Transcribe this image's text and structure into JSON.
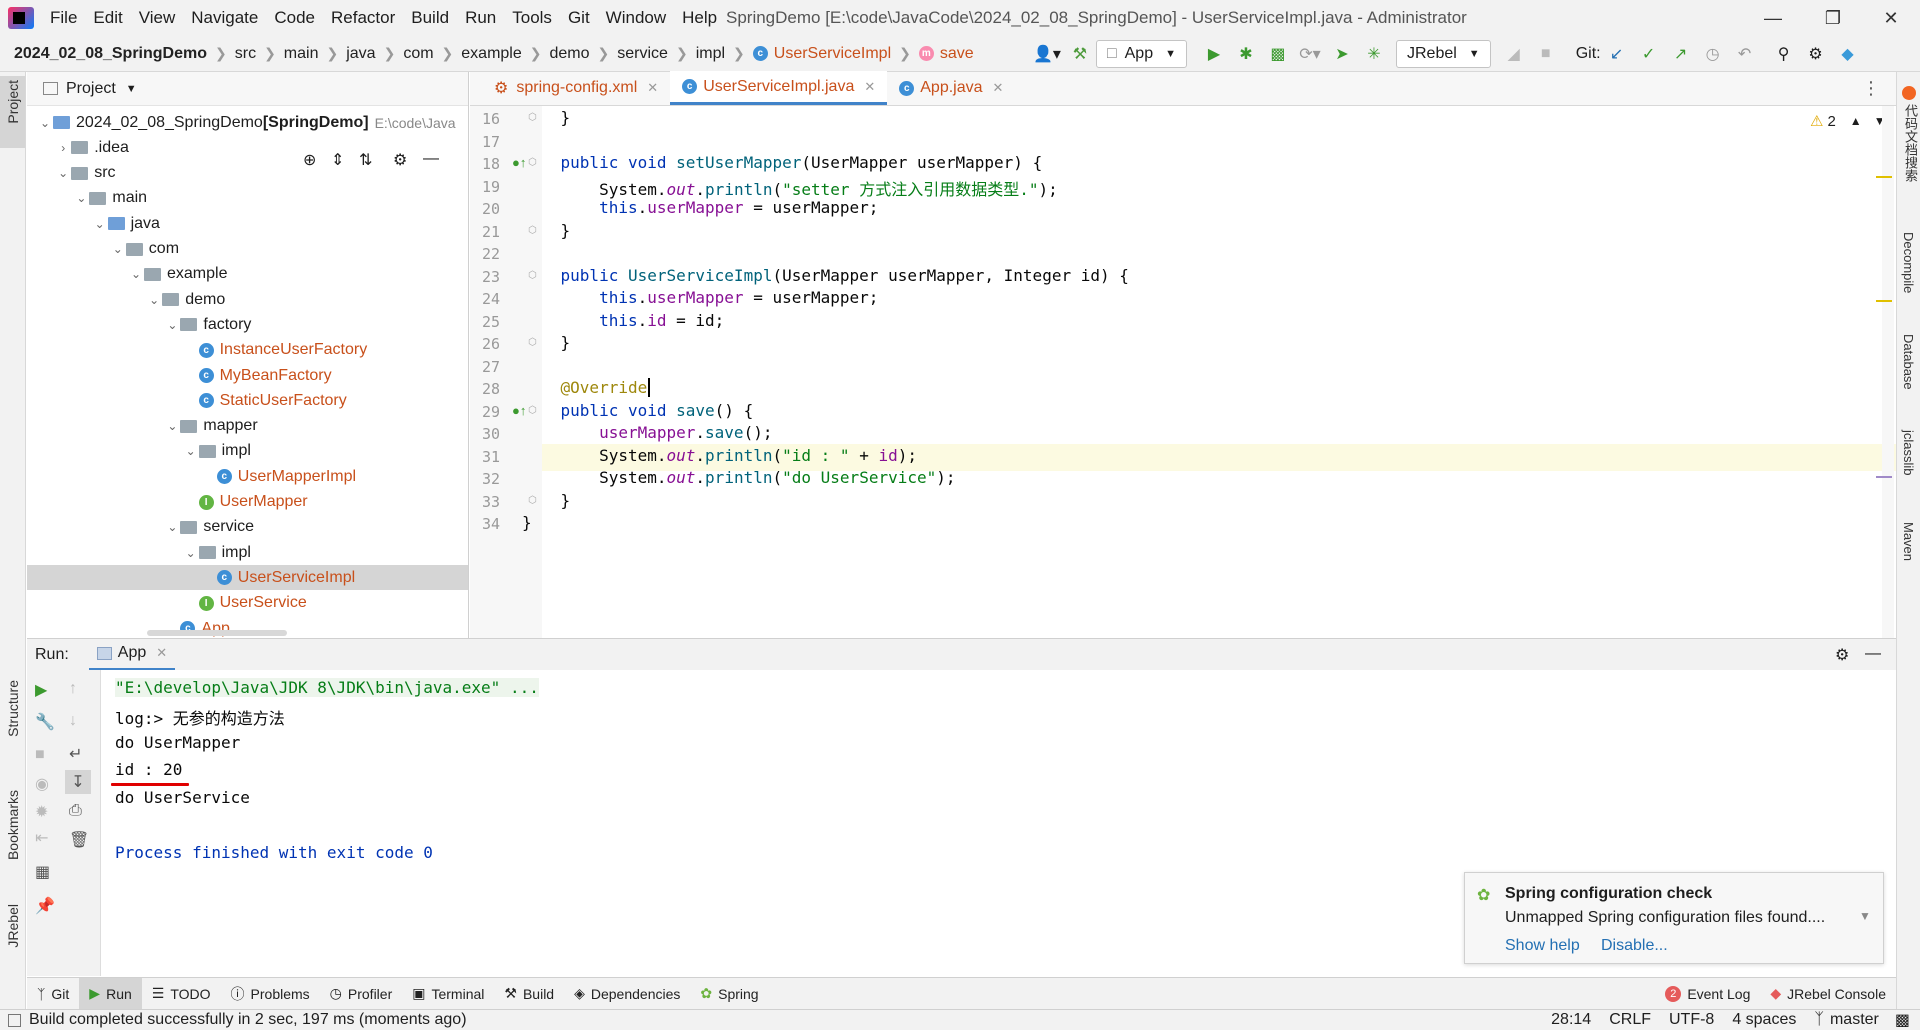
{
  "menubar": {
    "items": [
      "File",
      "Edit",
      "View",
      "Navigate",
      "Code",
      "Refactor",
      "Build",
      "Run",
      "Tools",
      "Git",
      "Window",
      "Help"
    ],
    "window_title": "SpringDemo [E:\\code\\JavaCode\\2024_02_08_SpringDemo] - UserServiceImpl.java - Administrator"
  },
  "navbar": {
    "breadcrumbs": [
      "2024_02_08_SpringDemo",
      "src",
      "main",
      "java",
      "com",
      "example",
      "demo",
      "service",
      "impl",
      "UserServiceImpl",
      "save"
    ],
    "run_config": "App",
    "jrebel": "JRebel",
    "git_label": "Git:"
  },
  "left_stripe": {
    "project": "Project",
    "structure": "Structure",
    "bookmarks": "Bookmarks",
    "jrebel": "JRebel"
  },
  "right_stripe": {
    "a": "代码文档搜索",
    "b": "Decompile",
    "c": "Database",
    "d": "jclasslib",
    "e": "Maven"
  },
  "project": {
    "title": "Project",
    "tree": [
      {
        "label": "2024_02_08_SpringDemo",
        "bold_suffix": "[SpringDemo]",
        "path": "E:\\code\\Java",
        "type": "module",
        "depth": 0,
        "open": true
      },
      {
        "label": ".idea",
        "type": "folder",
        "depth": 1,
        "open": false
      },
      {
        "label": "src",
        "type": "folder",
        "depth": 1,
        "open": true
      },
      {
        "label": "main",
        "type": "folder",
        "depth": 2,
        "open": true
      },
      {
        "label": "java",
        "type": "srcfolder",
        "depth": 3,
        "open": true
      },
      {
        "label": "com",
        "type": "pkg",
        "depth": 4,
        "open": true
      },
      {
        "label": "example",
        "type": "pkg",
        "depth": 5,
        "open": true
      },
      {
        "label": "demo",
        "type": "pkg",
        "depth": 6,
        "open": true
      },
      {
        "label": "factory",
        "type": "pkg",
        "depth": 7,
        "open": true
      },
      {
        "label": "InstanceUserFactory",
        "type": "class",
        "depth": 8
      },
      {
        "label": "MyBeanFactory",
        "type": "class",
        "depth": 8
      },
      {
        "label": "StaticUserFactory",
        "type": "class",
        "depth": 8
      },
      {
        "label": "mapper",
        "type": "pkg",
        "depth": 7,
        "open": true
      },
      {
        "label": "impl",
        "type": "pkg",
        "depth": 8,
        "open": true
      },
      {
        "label": "UserMapperImpl",
        "type": "class",
        "depth": 9
      },
      {
        "label": "UserMapper",
        "type": "interface",
        "depth": 8
      },
      {
        "label": "service",
        "type": "pkg",
        "depth": 7,
        "open": true
      },
      {
        "label": "impl",
        "type": "pkg",
        "depth": 8,
        "open": true
      },
      {
        "label": "UserServiceImpl",
        "type": "class",
        "depth": 9,
        "selected": true
      },
      {
        "label": "UserService",
        "type": "interface",
        "depth": 8
      },
      {
        "label": "App",
        "type": "class",
        "depth": 7
      }
    ]
  },
  "editor": {
    "tabs": [
      {
        "label": "spring-config.xml",
        "active": false
      },
      {
        "label": "UserServiceImpl.java",
        "active": true
      },
      {
        "label": "App.java",
        "active": false
      }
    ],
    "warnings": "2",
    "lines": [
      {
        "n": "16",
        "code": "    }"
      },
      {
        "n": "17",
        "code": ""
      },
      {
        "n": "18",
        "code": "    public void setUserMapper(UserMapper userMapper) {"
      },
      {
        "n": "19",
        "code": "        System.out.println(\"setter 方式注入引用数据类型.\");"
      },
      {
        "n": "20",
        "code": "        this.userMapper = userMapper;"
      },
      {
        "n": "21",
        "code": "    }"
      },
      {
        "n": "22",
        "code": ""
      },
      {
        "n": "23",
        "code": "    public UserServiceImpl(UserMapper userMapper, Integer id) {"
      },
      {
        "n": "24",
        "code": "        this.userMapper = userMapper;"
      },
      {
        "n": "25",
        "code": "        this.id = id;"
      },
      {
        "n": "26",
        "code": "    }"
      },
      {
        "n": "27",
        "code": ""
      },
      {
        "n": "28",
        "code": "    @Override"
      },
      {
        "n": "29",
        "code": "    public void save() {"
      },
      {
        "n": "30",
        "code": "        userMapper.save();"
      },
      {
        "n": "31",
        "code": "        System.out.println(\"id : \" + id);"
      },
      {
        "n": "32",
        "code": "        System.out.println(\"do UserService\");"
      },
      {
        "n": "33",
        "code": "    }"
      },
      {
        "n": "34",
        "code": "}"
      }
    ]
  },
  "run": {
    "label": "Run:",
    "tab": "App",
    "console": [
      "\"E:\\develop\\Java\\JDK 8\\JDK\\bin\\java.exe\" ...",
      "log:> 无参的构造方法",
      "do UserMapper",
      "id : 20",
      "do UserService",
      "",
      "Process finished with exit code 0"
    ]
  },
  "notification": {
    "title": "Spring configuration check",
    "body": "Unmapped Spring configuration files found....",
    "show_help": "Show help",
    "disable": "Disable..."
  },
  "bottom_tools": [
    "Git",
    "Run",
    "TODO",
    "Problems",
    "Profiler",
    "Terminal",
    "Build",
    "Dependencies",
    "Spring"
  ],
  "bottom_right": {
    "event_log": "Event Log",
    "event_count": "2",
    "jrebel_console": "JRebel Console"
  },
  "status": {
    "message": "Build completed successfully in 2 sec, 197 ms (moments ago)",
    "position": "28:14",
    "line_sep": "CRLF",
    "encoding": "UTF-8",
    "indent": "4 spaces",
    "branch": "master"
  },
  "colors": {
    "accent": "#4083c9",
    "class_name": "#c8501b",
    "underline": "#e00000"
  }
}
